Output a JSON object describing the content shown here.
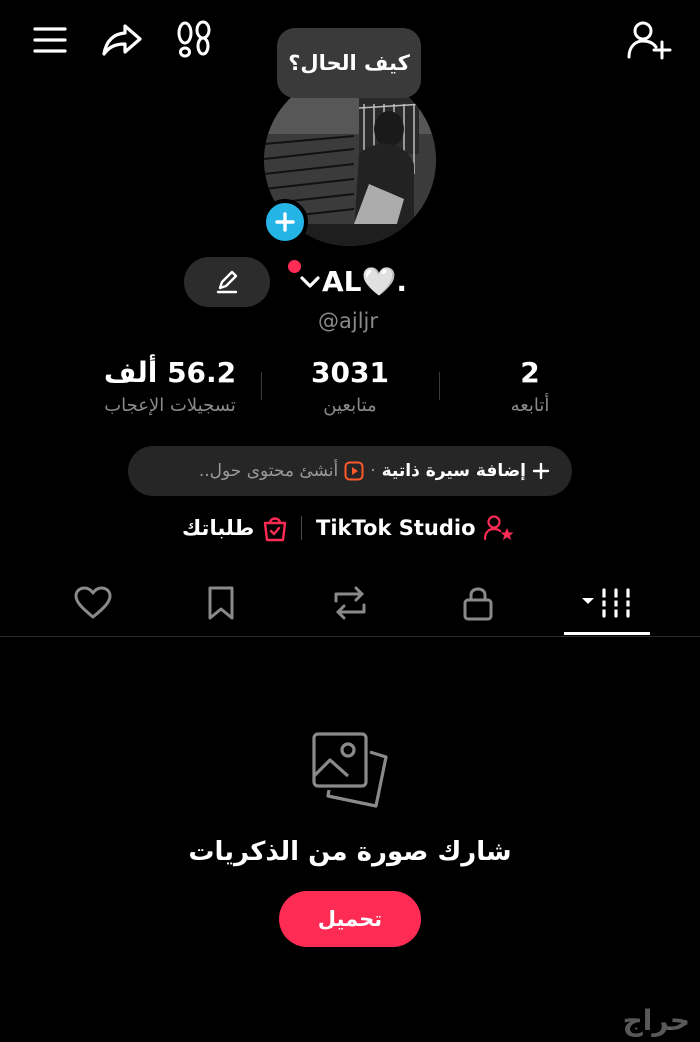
{
  "bubble": {
    "text": "كيف الحال؟"
  },
  "profile": {
    "display_name": "AL🤍.",
    "username": "@ajljr"
  },
  "stats": {
    "following": {
      "value": "2",
      "label": "أتابعه"
    },
    "followers": {
      "value": "3031",
      "label": "متابعين"
    },
    "likes": {
      "value": "56.2 ألف",
      "label": "تسجيلات الإعجاب"
    }
  },
  "bio": {
    "add_label": "إضافة سيرة ذاتية",
    "separator": "·",
    "hint": "أنشئ محتوى حول.."
  },
  "links": {
    "studio": "TikTok Studio",
    "orders": "طلباتك"
  },
  "tabs": {
    "active": "videos",
    "items": [
      "videos-grid",
      "private-lock",
      "reposts",
      "saved",
      "liked"
    ]
  },
  "empty_state": {
    "message": "شارك صورة من الذكريات",
    "upload_label": "تحميل"
  },
  "watermark": "حراج",
  "colors": {
    "accent": "#fe2c55",
    "avatar_add": "#24b5e6",
    "background": "#000000"
  }
}
